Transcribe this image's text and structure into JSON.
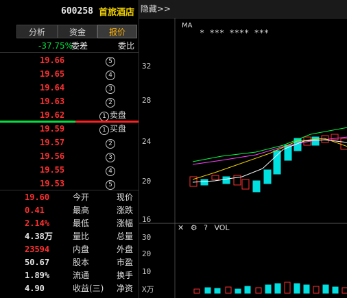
{
  "header": {
    "code": "600258",
    "name": "首旅酒店"
  },
  "tabs": [
    {
      "label": "报价"
    },
    {
      "label": "资金"
    },
    {
      "label": "分析"
    }
  ],
  "ratio": {
    "label": "委比",
    "value": "-37.75%",
    "suffix": "委差"
  },
  "asks": [
    {
      "price": "19.66",
      "level": "5"
    },
    {
      "price": "19.65",
      "level": "4"
    },
    {
      "price": "19.64",
      "level": "3"
    },
    {
      "price": "19.63",
      "level": "2"
    },
    {
      "price": "19.62",
      "level": "1",
      "side": "卖盘"
    }
  ],
  "bids": [
    {
      "price": "19.59",
      "level": "1",
      "side": "买盘"
    },
    {
      "price": "19.57",
      "level": "2"
    },
    {
      "price": "19.56",
      "level": "3"
    },
    {
      "price": "19.55",
      "level": "4"
    },
    {
      "price": "19.53",
      "level": "5"
    }
  ],
  "stats": [
    {
      "k": "现价",
      "v": "19.60",
      "k2": "今开",
      "color": "red"
    },
    {
      "k": "涨跌",
      "v": "0.41",
      "k2": "最高",
      "color": "red"
    },
    {
      "k": "涨幅",
      "v": "2.14%",
      "k2": "最低",
      "color": "red"
    },
    {
      "k": "总量",
      "v": "4.38万",
      "k2": "量比",
      "color": "white"
    },
    {
      "k": "外盘",
      "v": "23594",
      "k2": "内盘",
      "color": "red"
    },
    {
      "k": "市盈",
      "v": "50.67",
      "k2": "股本",
      "color": "white"
    },
    {
      "k": "换手",
      "v": "1.89%",
      "k2": "流通",
      "color": "white"
    },
    {
      "k": "净资",
      "v": "4.90",
      "k2": "收益(三)",
      "color": "white"
    }
  ],
  "chart": {
    "hide_label": "隐藏>>",
    "ma_label": "MA",
    "stars": "*   ***   ****   ***",
    "price_ticks": [
      "32",
      "28",
      "24",
      "20",
      "16"
    ],
    "vol_label": "VOL",
    "vol_ticks": [
      "30",
      "20",
      "10",
      "X万"
    ]
  },
  "colors": {
    "up": "#ff3030",
    "down": "#00e0e0",
    "ma1": "#ffffff",
    "ma2": "#f0d000",
    "ma3": "#ff40ff",
    "ma4": "#00ff40"
  }
}
